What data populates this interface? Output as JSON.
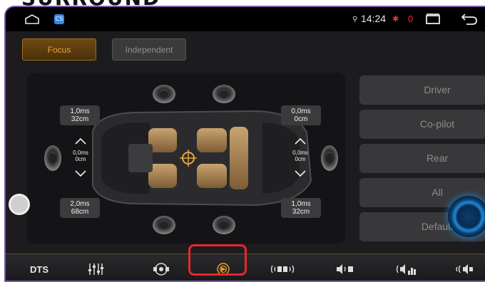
{
  "banner": "SURROUND",
  "status": {
    "time": "14:24",
    "volume": "0",
    "app_badge": "CS"
  },
  "modes": {
    "focus": "Focus",
    "independent": "Independent",
    "selected": "Focus"
  },
  "delays": {
    "front_left": {
      "ms": "1,0ms",
      "cm": "32cm"
    },
    "front_right": {
      "ms": "0,0ms",
      "cm": "0cm"
    },
    "center_left": {
      "ms": "0,0ms",
      "cm": "0cm"
    },
    "center_right": {
      "ms": "0,0ms",
      "cm": "0cm"
    },
    "rear_left": {
      "ms": "2,0ms",
      "cm": "68cm"
    },
    "rear_right": {
      "ms": "1,0ms",
      "cm": "32cm"
    }
  },
  "positions": [
    "Driver",
    "Co-pilot",
    "Rear",
    "All",
    "Default"
  ],
  "tabs": {
    "dts": "DTS",
    "items": [
      "equalizer-icon",
      "balance-icon",
      "surround-icon",
      "sound-field-icon",
      "speaker-left-icon",
      "speaker-bass-icon",
      "speaker-wave-icon"
    ],
    "active": "surround-icon"
  },
  "colors": {
    "accent": "#e6a53a",
    "active_tab": "#f0a030",
    "highlight": "#e8262e",
    "volume": "#ff2a2a"
  }
}
